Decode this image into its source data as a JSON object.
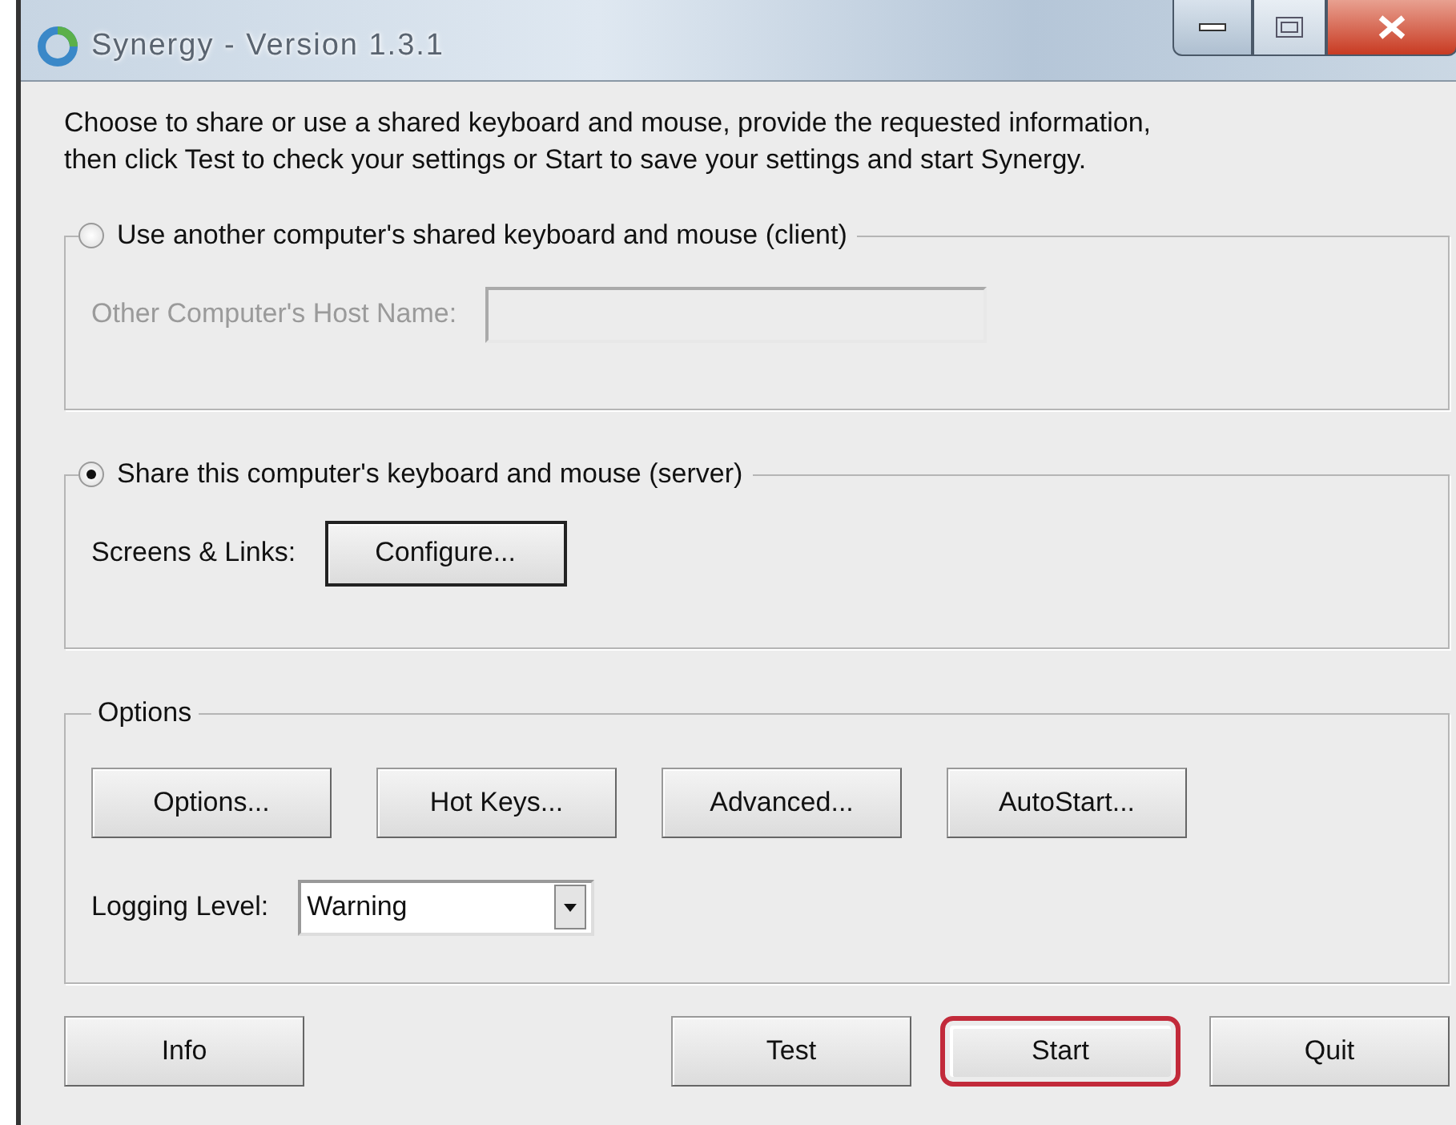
{
  "window": {
    "title": "Synergy - Version 1.3.1"
  },
  "description": "Choose to share or use a shared keyboard and mouse, provide the requested information,\nthen click Test to check your settings or Start to save your settings and start Synergy.",
  "modes": [
    {
      "kind": "client",
      "label": "Use another computer's shared keyboard and mouse (client)",
      "selected": false,
      "disabled": true,
      "host_label": "Other Computer's Host Name:"
    },
    {
      "kind": "server",
      "label": "Share this computer's keyboard and mouse (server)",
      "selected": true,
      "disabled": false,
      "screens_label": "Screens & Links:",
      "configure_button": "Configure..."
    }
  ],
  "options": {
    "title": "Options",
    "buttons": [
      "Options...",
      "Hot Keys...",
      "Advanced...",
      "AutoStart..."
    ],
    "logging_label": "Logging Level:",
    "logging_value": "Warning"
  },
  "buttons": [
    {
      "label": "Info",
      "highlighted": false
    },
    {
      "label": "Test",
      "highlighted": false
    },
    {
      "label": "Start",
      "highlighted": true
    },
    {
      "label": "Quit",
      "highlighted": false
    }
  ]
}
